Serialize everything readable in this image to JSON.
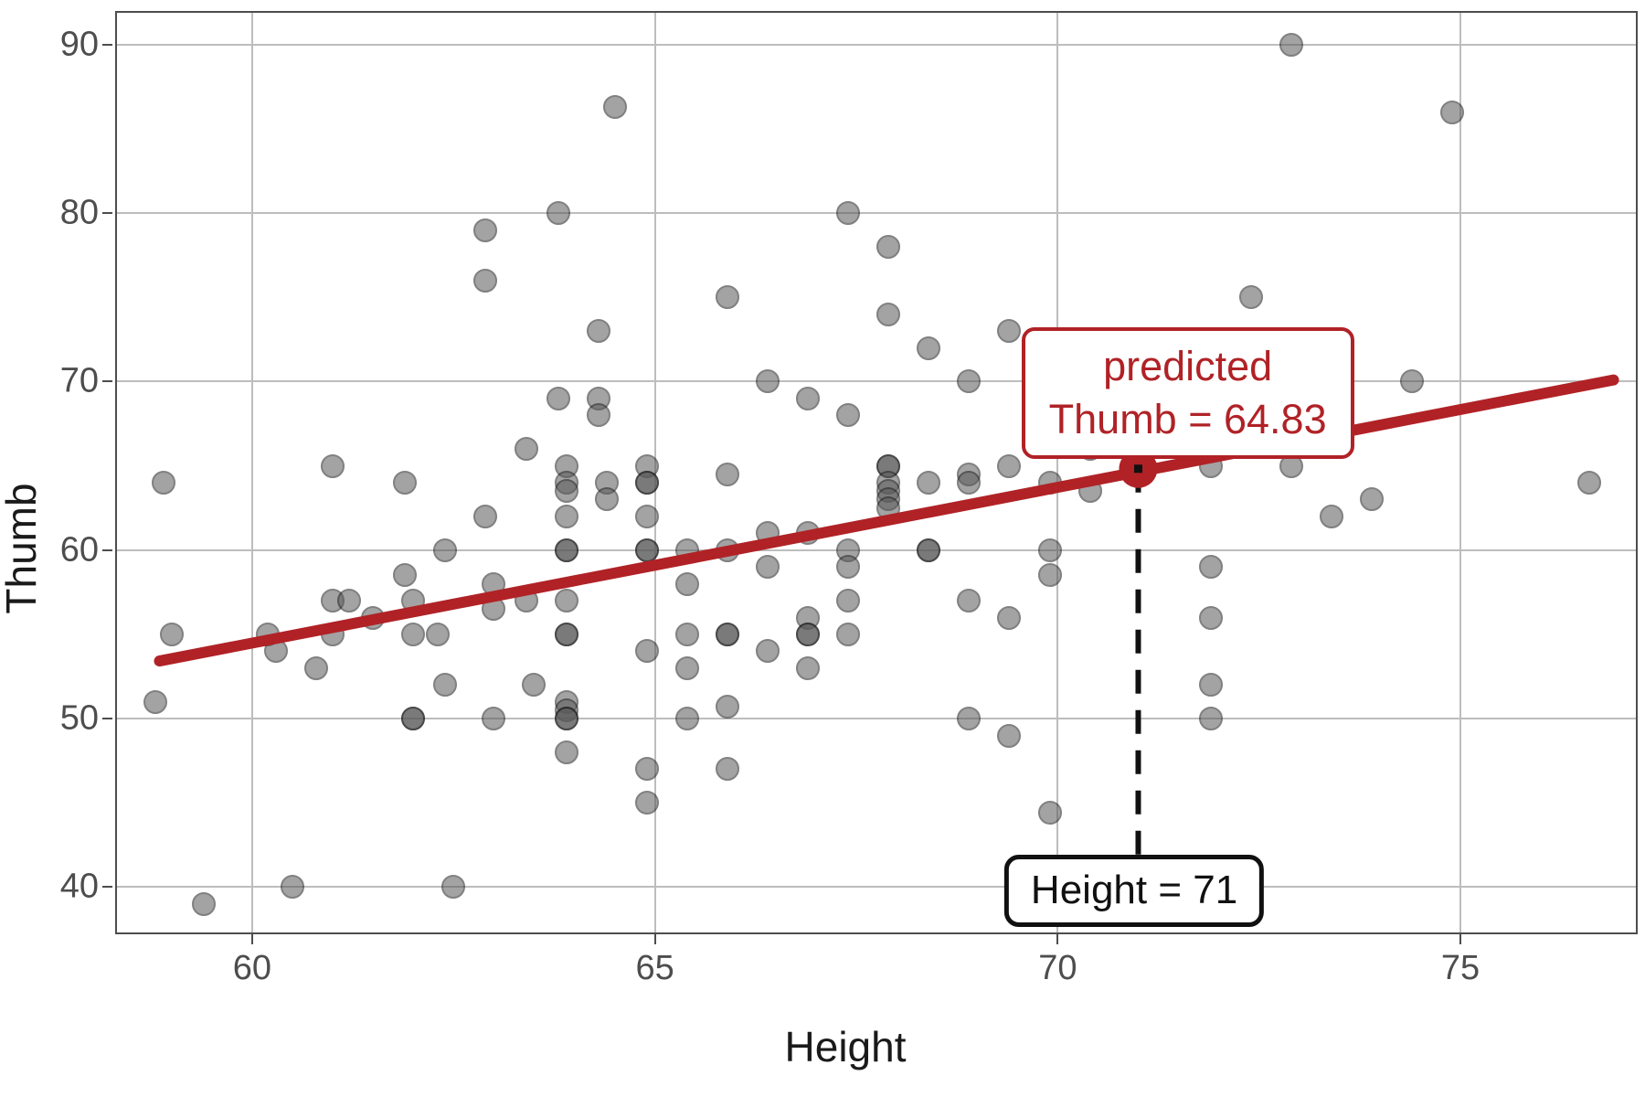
{
  "chart_data": {
    "type": "scatter",
    "title": "",
    "xlabel": "Height",
    "ylabel": "Thumb",
    "xlim": [
      58.3,
      77.2
    ],
    "ylim": [
      37.2,
      92.0
    ],
    "xticks": [
      60,
      65,
      70,
      75
    ],
    "yticks": [
      40,
      50,
      60,
      70,
      80,
      90
    ],
    "grid": true,
    "legend": "none",
    "point_color": "#595959",
    "point_opacity": 0.55,
    "regression": {
      "type": "line",
      "color": "#b02226",
      "x_start": 58.85,
      "y_start": 53.42,
      "x_end": 76.9,
      "y_end": 70.1,
      "slope": 0.924,
      "intercept": -1.18
    },
    "highlight_point": {
      "x": 71,
      "y": 64.83,
      "color": "#b02226"
    },
    "reference_line": {
      "style": "dashed",
      "color": "#111111",
      "x": 71,
      "y_top": 64.83,
      "y_bottom": 40.6
    },
    "points": [
      [
        58.9,
        64.0
      ],
      [
        58.8,
        51.0
      ],
      [
        59.0,
        55.0
      ],
      [
        59.4,
        39.0
      ],
      [
        60.2,
        55.0
      ],
      [
        60.3,
        54.0
      ],
      [
        60.5,
        40.0
      ],
      [
        60.8,
        53.0
      ],
      [
        61.0,
        65.0
      ],
      [
        61.0,
        57.0
      ],
      [
        61.0,
        55.0
      ],
      [
        61.2,
        57.0
      ],
      [
        61.5,
        56.0
      ],
      [
        61.9,
        64.0
      ],
      [
        61.9,
        58.5
      ],
      [
        62.0,
        57.0
      ],
      [
        62.0,
        55.0
      ],
      [
        62.0,
        50.0
      ],
      [
        62.0,
        50.0
      ],
      [
        62.3,
        55.0
      ],
      [
        62.4,
        60.0
      ],
      [
        62.4,
        52.0
      ],
      [
        62.5,
        40.0
      ],
      [
        62.9,
        79.0
      ],
      [
        62.9,
        76.0
      ],
      [
        62.9,
        62.0
      ],
      [
        63.0,
        58.0
      ],
      [
        63.0,
        56.5
      ],
      [
        63.0,
        50.0
      ],
      [
        63.4,
        66.0
      ],
      [
        63.4,
        57.0
      ],
      [
        63.5,
        52.0
      ],
      [
        63.8,
        80.0
      ],
      [
        63.8,
        69.0
      ],
      [
        63.9,
        65.0
      ],
      [
        63.9,
        64.0
      ],
      [
        63.9,
        63.5
      ],
      [
        63.9,
        62.0
      ],
      [
        63.9,
        60.0
      ],
      [
        63.9,
        60.0
      ],
      [
        63.9,
        57.0
      ],
      [
        63.9,
        55.0
      ],
      [
        63.9,
        55.0
      ],
      [
        63.9,
        51.0
      ],
      [
        63.9,
        50.5
      ],
      [
        63.9,
        50.0
      ],
      [
        63.9,
        50.0
      ],
      [
        63.9,
        48.0
      ],
      [
        64.3,
        73.0
      ],
      [
        64.3,
        69.0
      ],
      [
        64.3,
        68.0
      ],
      [
        64.4,
        64.0
      ],
      [
        64.4,
        63.0
      ],
      [
        64.5,
        86.3
      ],
      [
        64.9,
        65.0
      ],
      [
        64.9,
        64.0
      ],
      [
        64.9,
        64.0
      ],
      [
        64.9,
        62.0
      ],
      [
        64.9,
        60.0
      ],
      [
        64.9,
        60.0
      ],
      [
        64.9,
        54.0
      ],
      [
        64.9,
        47.0
      ],
      [
        64.9,
        45.0
      ],
      [
        65.4,
        60.0
      ],
      [
        65.4,
        58.0
      ],
      [
        65.4,
        55.0
      ],
      [
        65.4,
        53.0
      ],
      [
        65.4,
        50.0
      ],
      [
        65.9,
        75.0
      ],
      [
        65.9,
        64.5
      ],
      [
        65.9,
        60.0
      ],
      [
        65.9,
        55.0
      ],
      [
        65.9,
        55.0
      ],
      [
        65.9,
        50.7
      ],
      [
        65.9,
        47.0
      ],
      [
        66.4,
        70.0
      ],
      [
        66.4,
        61.0
      ],
      [
        66.4,
        59.0
      ],
      [
        66.4,
        54.0
      ],
      [
        66.9,
        69.0
      ],
      [
        66.9,
        61.0
      ],
      [
        66.9,
        56.0
      ],
      [
        66.9,
        55.0
      ],
      [
        66.9,
        55.0
      ],
      [
        66.9,
        53.0
      ],
      [
        67.4,
        80.0
      ],
      [
        67.4,
        68.0
      ],
      [
        67.4,
        60.0
      ],
      [
        67.4,
        59.0
      ],
      [
        67.4,
        57.0
      ],
      [
        67.4,
        55.0
      ],
      [
        67.9,
        78.0
      ],
      [
        67.9,
        74.0
      ],
      [
        67.9,
        65.0
      ],
      [
        67.9,
        65.0
      ],
      [
        67.9,
        64.0
      ],
      [
        67.9,
        63.5
      ],
      [
        67.9,
        63.0
      ],
      [
        67.9,
        62.5
      ],
      [
        68.4,
        72.0
      ],
      [
        68.4,
        64.0
      ],
      [
        68.4,
        60.0
      ],
      [
        68.4,
        60.0
      ],
      [
        68.9,
        70.0
      ],
      [
        68.9,
        64.5
      ],
      [
        68.9,
        64.0
      ],
      [
        68.9,
        57.0
      ],
      [
        68.9,
        50.0
      ],
      [
        69.4,
        73.0
      ],
      [
        69.4,
        65.0
      ],
      [
        69.4,
        56.0
      ],
      [
        69.4,
        49.0
      ],
      [
        69.9,
        64.0
      ],
      [
        69.9,
        60.0
      ],
      [
        69.9,
        58.5
      ],
      [
        69.9,
        44.4
      ],
      [
        70.4,
        66.0
      ],
      [
        70.4,
        63.5
      ],
      [
        71.9,
        65.0
      ],
      [
        71.9,
        59.0
      ],
      [
        71.9,
        56.0
      ],
      [
        71.9,
        52.0
      ],
      [
        71.9,
        50.0
      ],
      [
        72.4,
        75.0
      ],
      [
        72.9,
        90.0
      ],
      [
        72.9,
        65.0
      ],
      [
        73.4,
        62.0
      ],
      [
        73.9,
        63.0
      ],
      [
        74.4,
        70.0
      ],
      [
        74.9,
        86.0
      ],
      [
        76.6,
        64.0
      ]
    ]
  },
  "annotations": {
    "predicted": {
      "line1": "predicted",
      "line2": "Thumb = 64.83",
      "color": "#b02226"
    },
    "height": {
      "text": "Height = 71",
      "color": "#111111"
    }
  },
  "axes": {
    "y_title": "Thumb",
    "x_title": "Height",
    "y_tick_labels": [
      "90",
      "80",
      "70",
      "60",
      "50",
      "40"
    ],
    "x_tick_labels": [
      "60",
      "65",
      "70",
      "75"
    ]
  }
}
